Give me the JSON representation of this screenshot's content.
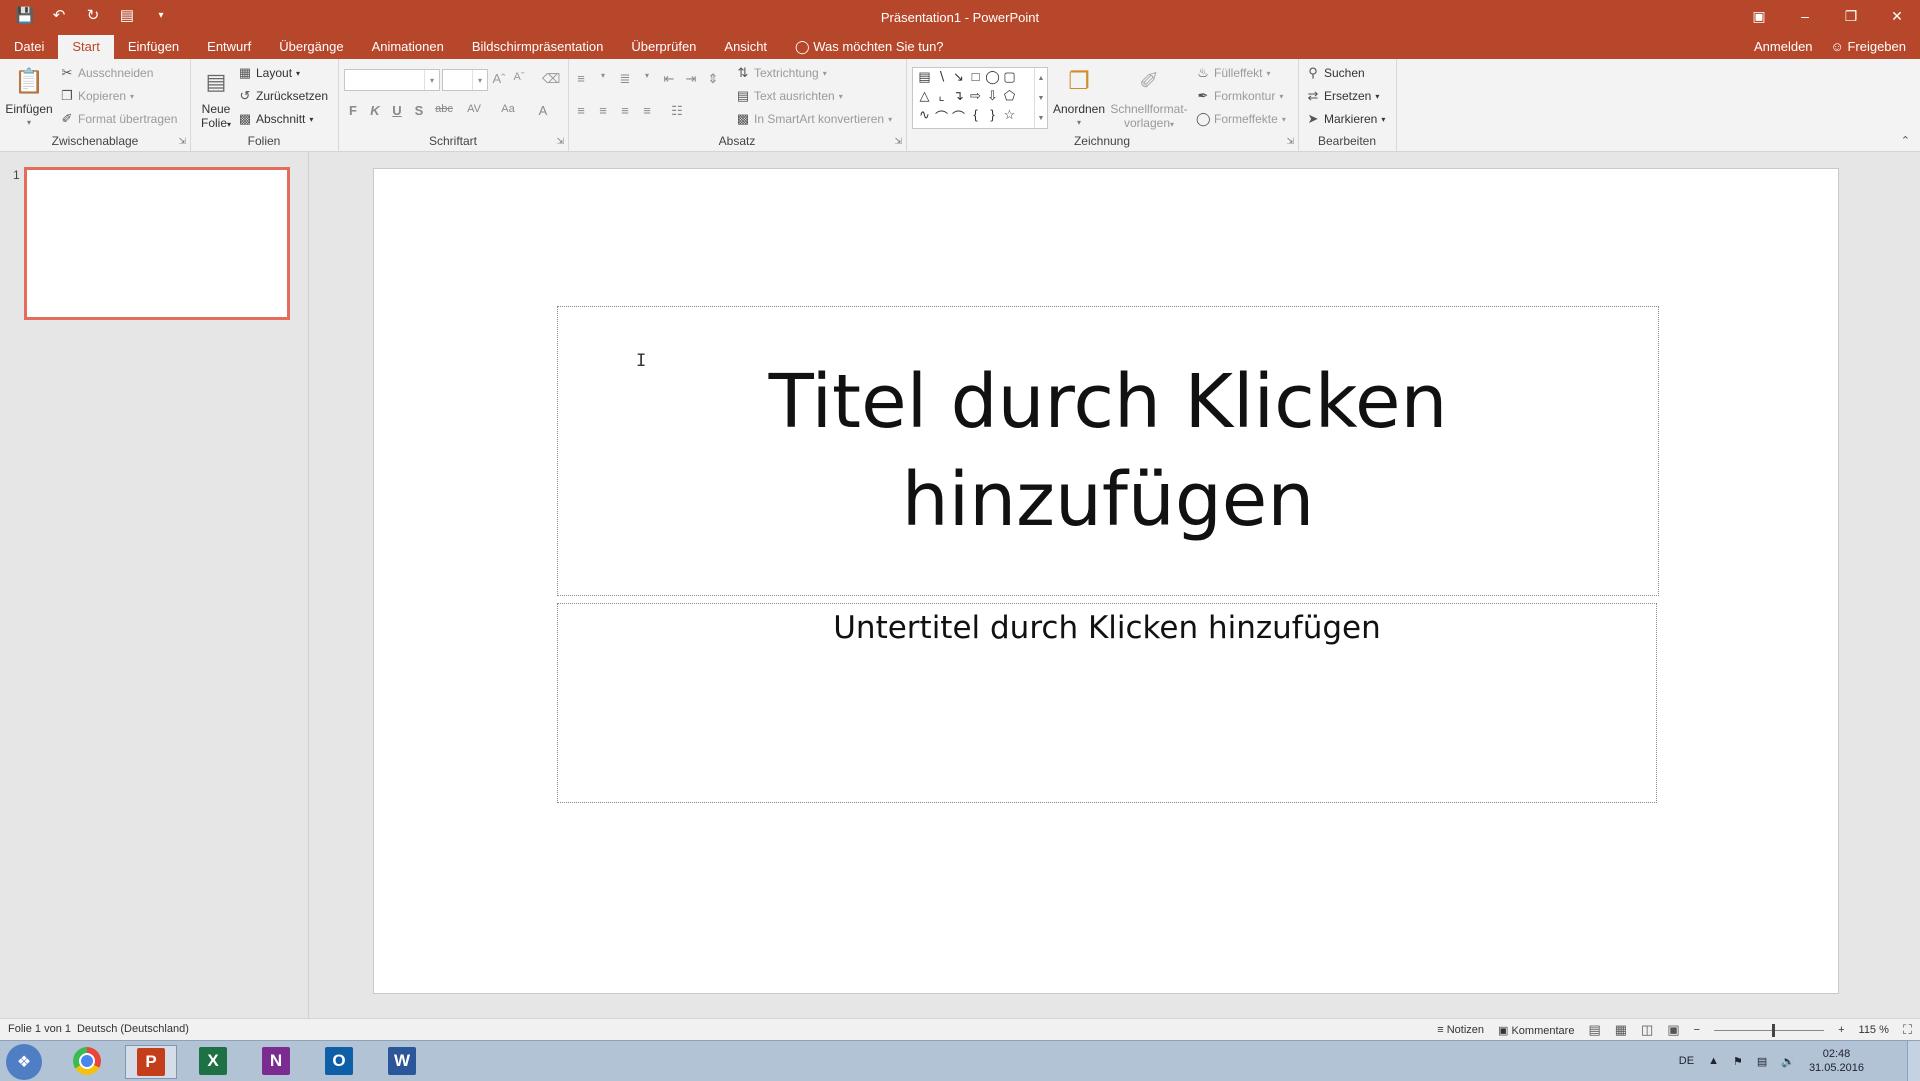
{
  "titlebar": {
    "title": "Präsentation1 - PowerPoint",
    "qat_icons": [
      "save-icon",
      "undo-icon",
      "redo-icon",
      "present-from-start-icon",
      "customize-qat-icon"
    ]
  },
  "tabs": [
    "Datei",
    "Start",
    "Einfügen",
    "Entwurf",
    "Übergänge",
    "Animationen",
    "Bildschirmpräsentation",
    "Überprüfen",
    "Ansicht"
  ],
  "active_tab": "Start",
  "tell_me": "Was möchten Sie tun?",
  "account": {
    "signin": "Anmelden",
    "share": "Freigeben"
  },
  "ribbon": {
    "clipboard": {
      "label": "Zwischenablage",
      "paste": "Einfügen",
      "cut": "Ausschneiden",
      "copy": "Kopieren",
      "format_painter": "Format übertragen"
    },
    "slides": {
      "label": "Folien",
      "new_slide_line1": "Neue",
      "new_slide_line2": "Folie",
      "layout": "Layout",
      "reset": "Zurücksetzen",
      "section": "Abschnitt"
    },
    "font": {
      "label": "Schriftart",
      "font_name": "",
      "font_size": "",
      "bold": "F",
      "italic": "K",
      "underline": "U",
      "shadow": "S",
      "strike": "abc",
      "spacing": "AV",
      "case": "Aa",
      "color": "A"
    },
    "paragraph": {
      "label": "Absatz",
      "text_direction": "Textrichtung",
      "align_text": "Text ausrichten",
      "smartart": "In SmartArt konvertieren"
    },
    "drawing": {
      "label": "Zeichnung",
      "arrange": "Anordnen",
      "quick_styles_line1": "Schnellformat-",
      "quick_styles_line2": "vorlagen",
      "fill": "Fülleffekt",
      "outline": "Formkontur",
      "effects": "Formeffekte"
    },
    "editing": {
      "label": "Bearbeiten",
      "find": "Suchen",
      "replace": "Ersetzen",
      "select": "Markieren"
    }
  },
  "slide_panel": {
    "slide_number": "1"
  },
  "slide": {
    "title_placeholder": "Titel durch Klicken hinzufügen",
    "subtitle_placeholder": "Untertitel durch Klicken hinzufügen"
  },
  "statusbar": {
    "slide_info": "Folie 1 von 1",
    "language": "Deutsch (Deutschland)",
    "notes": "Notizen",
    "comments": "Kommentare",
    "zoom": "115 %"
  },
  "taskbar": {
    "apps": [
      {
        "name": "chrome",
        "letter": "",
        "color": "#e8453c",
        "active": false
      },
      {
        "name": "powerpoint",
        "letter": "P",
        "color": "#c43e1c",
        "active": true
      },
      {
        "name": "excel",
        "letter": "X",
        "color": "#1e7145",
        "active": false
      },
      {
        "name": "onenote",
        "letter": "N",
        "color": "#7b2c91",
        "active": false
      },
      {
        "name": "outlook",
        "letter": "O",
        "color": "#0f5fa8",
        "active": false
      },
      {
        "name": "word",
        "letter": "W",
        "color": "#2b579a",
        "active": false
      }
    ],
    "language": "DE",
    "time": "02:48",
    "date": "31.05.2016"
  },
  "colors": {
    "accent": "#b7472a",
    "thumb_border": "#e46c5a"
  }
}
